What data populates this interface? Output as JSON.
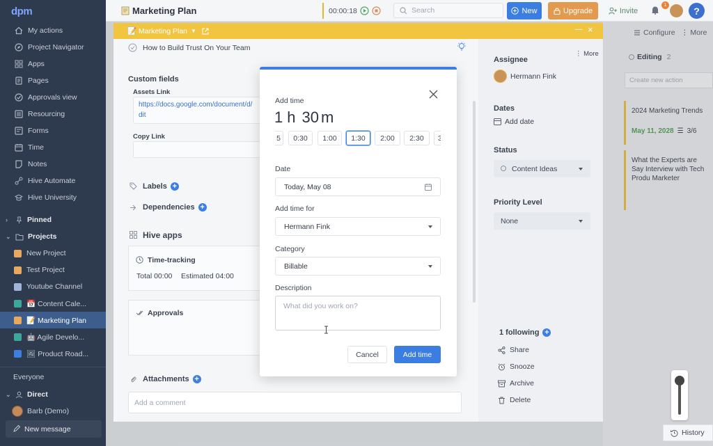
{
  "app": {
    "logo": "dpm"
  },
  "sidebar": {
    "items": [
      {
        "label": "My actions",
        "icon": "home-icon"
      },
      {
        "label": "Project Navigator",
        "icon": "compass-icon"
      },
      {
        "label": "Apps",
        "icon": "grid-icon"
      },
      {
        "label": "Pages",
        "icon": "pages-icon"
      },
      {
        "label": "Approvals view",
        "icon": "check-circle-icon"
      },
      {
        "label": "Resourcing",
        "icon": "list-icon"
      },
      {
        "label": "Forms",
        "icon": "form-icon"
      },
      {
        "label": "Time",
        "icon": "calendar-icon"
      },
      {
        "label": "Notes",
        "icon": "note-icon"
      },
      {
        "label": "Hive Automate",
        "icon": "automate-icon"
      },
      {
        "label": "Hive University",
        "icon": "graduation-icon"
      }
    ],
    "pinned": "Pinned",
    "projects_title": "Projects",
    "projects": [
      {
        "label": "New Project",
        "color": "#e8a860"
      },
      {
        "label": "Test Project",
        "color": "#e8a860"
      },
      {
        "label": "Youtube Channel",
        "color": "#9fb4d8"
      },
      {
        "label": "📅 Content Cale...",
        "color": "#3aa89a"
      },
      {
        "label": "📝 Marketing Plan",
        "color": "#e8a860"
      },
      {
        "label": "🤖 Agile Develo...",
        "color": "#3aa89a"
      },
      {
        "label": "🖼 Product Road...",
        "color": "#3d7ee0"
      }
    ],
    "everyone": "Everyone",
    "direct": "Direct",
    "dm_user": "Barb (Demo)",
    "new_message": "New message"
  },
  "topbar": {
    "title": "Marketing Plan",
    "timer": "00:00:18",
    "search_placeholder": "Search",
    "new_label": "New",
    "upgrade_label": "Upgrade",
    "invite_label": "Invite",
    "notif_count": "1",
    "help_label": "?",
    "configure_label": "Configure",
    "more_label": "More"
  },
  "panel": {
    "breadcrumb": "📝 Marketing Plan",
    "task_title": "How to Build Trust On Your Team",
    "custom_fields": "Custom fields",
    "assets_link_label": "Assets Link",
    "assets_link_line1": "https://docs.google.com/document/d/",
    "assets_link_line2": "dit",
    "copy_link_label": "Copy Link",
    "labels": "Labels",
    "dependencies": "Dependencies",
    "hive_apps": "Hive apps",
    "time_tracking": "Time-tracking",
    "total": "Total 00:00",
    "estimated": "Estimated 04:00",
    "approvals": "Approvals",
    "attachments": "Attachments",
    "comment_placeholder": "Add a comment"
  },
  "modal": {
    "title": "Add time",
    "duration": {
      "hours": "1",
      "h": "h",
      "minutes": "30",
      "m": "m"
    },
    "chips": [
      "5",
      "0:30",
      "1:00",
      "1:30",
      "2:00",
      "2:30",
      "3"
    ],
    "selected_chip": "1:30",
    "date_label": "Date",
    "date_value": "Today, May 08",
    "for_label": "Add time for",
    "for_value": "Hermann Fink",
    "category_label": "Category",
    "category_value": "Billable",
    "description_label": "Description",
    "description_placeholder": "What did you work on?",
    "cancel_label": "Cancel",
    "submit_label": "Add time",
    "accent": "#3b7de0"
  },
  "details": {
    "more_label": "More",
    "assignee_label": "Assignee",
    "assignee": "Hermann Fink",
    "dates_label": "Dates",
    "add_date": "Add date",
    "status_label": "Status",
    "status_value": "Content Ideas",
    "priority_label": "Priority Level",
    "priority_value": "None",
    "following": "1 following",
    "actions": [
      "Share",
      "Snooze",
      "Archive",
      "Delete"
    ]
  },
  "kanban": {
    "column": "Editing",
    "count": "2",
    "create_placeholder": "Create new action",
    "card1_title": "2024 Marketing Trends",
    "card1_date": "May 11, 2028",
    "card1_checklist": "3/6",
    "card2_title": "What the Experts are Say Interview with Tech Produ Marketer"
  },
  "history_label": "History"
}
